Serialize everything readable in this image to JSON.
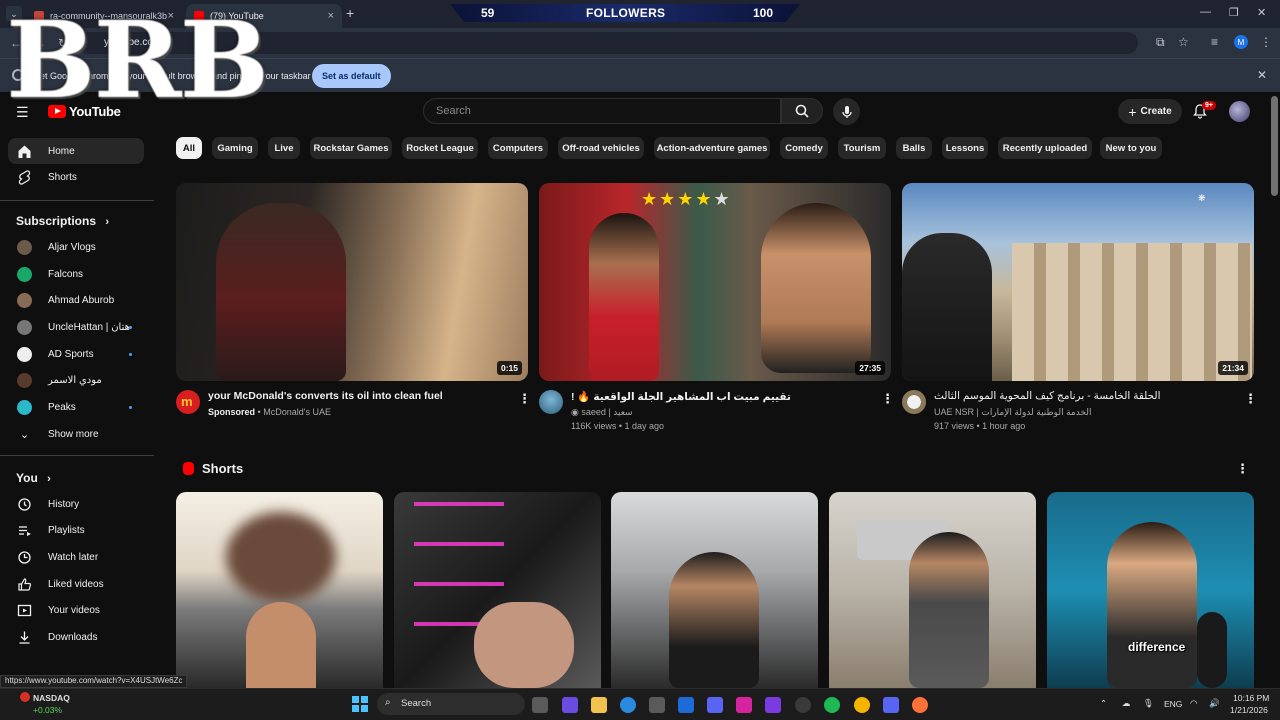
{
  "browser": {
    "tabs": [
      {
        "title": "ra-community--mansouralk3b…",
        "close": "×"
      },
      {
        "title": "(79) YouTube",
        "close": "×"
      }
    ],
    "new_tab": "+",
    "url": "youtube.com",
    "infobar": {
      "message": "Set Google Chrome as your default browser and pin it to your taskbar",
      "button": "Set as default",
      "close": "✕"
    },
    "window_controls": [
      "—",
      "❐",
      "✕"
    ]
  },
  "followers_overlay": {
    "left_count": "59",
    "label": "FOLLOWERS",
    "right_count": "100"
  },
  "brb_overlay": "BRB",
  "masthead": {
    "logo": "YouTube",
    "search_placeholder": "Search",
    "create_label": "Create",
    "notif_badge": "9+"
  },
  "sidebar": {
    "top": [
      {
        "label": "Home",
        "icon": "home-icon"
      },
      {
        "label": "Shorts",
        "icon": "shorts-icon"
      }
    ],
    "subs_header": "Subscriptions",
    "subscriptions": [
      {
        "label": "Aljar Vlogs",
        "color": "#6b5a4a",
        "dot": false
      },
      {
        "label": "Falcons",
        "color": "#1aa86a",
        "dot": false
      },
      {
        "label": "Ahmad Aburob",
        "color": "#8a6b55",
        "dot": false
      },
      {
        "label": "UncleHattan | هتان",
        "color": "#777777",
        "dot": true
      },
      {
        "label": "AD Sports",
        "color": "#eeeeee",
        "dot": true
      },
      {
        "label": "مودي الاسمر",
        "color": "#5a3a2a",
        "dot": false
      },
      {
        "label": "Peaks",
        "color": "#2bb8c8",
        "dot": true
      }
    ],
    "show_more": "Show more",
    "you_header": "You",
    "you_items": [
      {
        "label": "History",
        "icon": "history-icon"
      },
      {
        "label": "Playlists",
        "icon": "playlists-icon"
      },
      {
        "label": "Watch later",
        "icon": "watch-later-icon"
      },
      {
        "label": "Liked videos",
        "icon": "like-icon"
      },
      {
        "label": "Your videos",
        "icon": "your-videos-icon"
      },
      {
        "label": "Downloads",
        "icon": "download-icon"
      }
    ]
  },
  "chips": [
    "All",
    "Gaming",
    "Live",
    "Rockstar Games",
    "Rocket League",
    "Computers",
    "Off-road vehicles",
    "Action-adventure games",
    "Comedy",
    "Tourism",
    "Balls",
    "Lessons",
    "Recently uploaded",
    "New to you"
  ],
  "videos": [
    {
      "title": "your McDonald's converts its oil into clean fuel",
      "channel_prefix": "Sponsored",
      "channel": "McDonald's UAE",
      "meta": "",
      "duration": "0:15"
    },
    {
      "title": "! 🔥 تقييم مبيت اب المشاهير الجلة الواقعية",
      "channel": "saeed | سعيد",
      "meta": "116K views • 1 day ago",
      "duration": "27:35"
    },
    {
      "title": "الحلقة الخامسة - برنامج كيف المحوية الموسم الثالث",
      "channel": "UAE NSR | الخدمة الوطنية لدولة الإمارات",
      "meta": "917 views • 1 hour ago",
      "duration": "21:34"
    }
  ],
  "shorts": {
    "header": "Shorts",
    "caption": "difference"
  },
  "status_url": "https://www.youtube.com/watch?v=X4USJtWe6Zc",
  "taskbar": {
    "ticker": "NASDAQ",
    "ticker_change": "+0.03%",
    "search": "Search",
    "lang": "ENG",
    "time": "10:16 PM",
    "date": "1/21/2026"
  }
}
